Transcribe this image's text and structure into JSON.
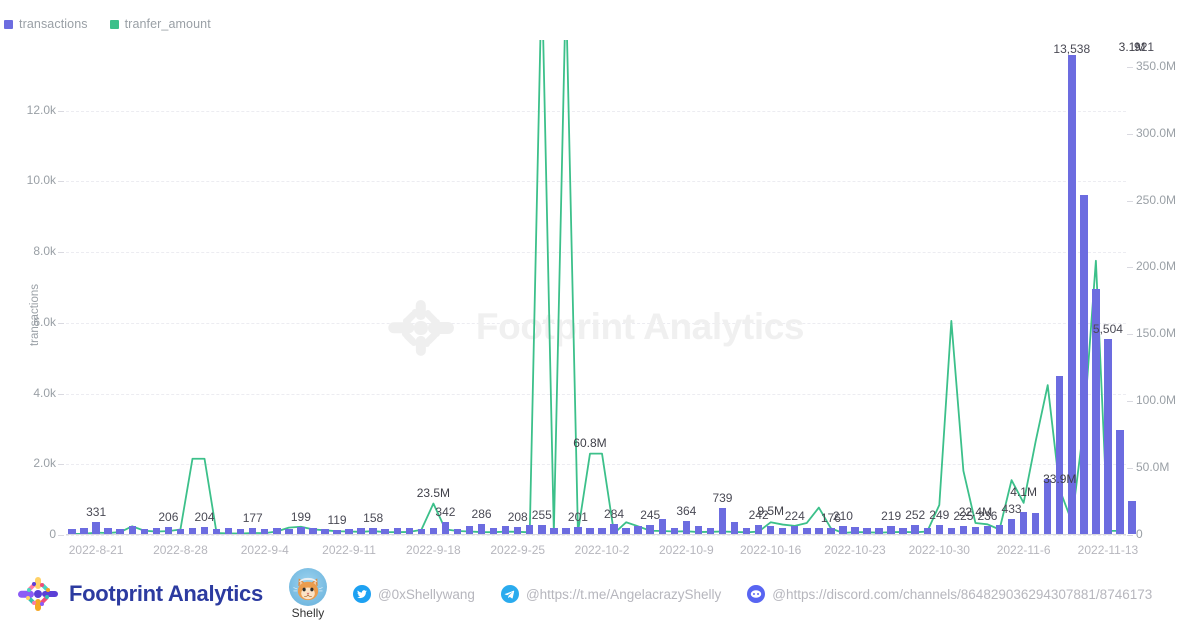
{
  "legend": {
    "items": [
      {
        "label": "transactions",
        "color": "#6c6ce0",
        "icon": "square-swatch-icon"
      },
      {
        "label": "tranfer_amount",
        "color": "#3cc08a",
        "icon": "square-swatch-icon"
      }
    ]
  },
  "watermark": {
    "text": "Footprint Analytics",
    "mark": "flower-logo-icon"
  },
  "footer": {
    "brand": {
      "name": "Footprint Analytics",
      "mark": "flower-logo-icon"
    },
    "avatar": {
      "name": "Shelly",
      "icon": "cat-avatar-icon"
    },
    "socials": [
      {
        "icon": "twitter-icon",
        "color": "#1da1f2",
        "handle": "@0xShellywang"
      },
      {
        "icon": "telegram-icon",
        "color": "#2aabee",
        "handle": "@https://t.me/AngelacrazyShelly"
      },
      {
        "icon": "discord-icon",
        "color": "#5865f2",
        "handle": "@https://discord.com/channels/864829036294307881/8746173"
      }
    ]
  },
  "chart_data": {
    "type": "bar",
    "title": "",
    "xlabel": "",
    "ylabel": "transactions",
    "y2label": "",
    "grid": true,
    "legend_position": "top-left",
    "ylim": [
      0,
      14000
    ],
    "y2lim": [
      0,
      370000000
    ],
    "yticks": [
      "0",
      "2.0k",
      "4.0k",
      "6.0k",
      "8.0k",
      "10.0k",
      "12.0k"
    ],
    "ytick_values": [
      0,
      2000,
      4000,
      6000,
      8000,
      10000,
      12000
    ],
    "y2ticks": [
      "0",
      "50.0M",
      "100.0M",
      "150.0M",
      "200.0M",
      "250.0M",
      "300.0M",
      "350.0M"
    ],
    "y2tick_values": [
      0,
      50000000,
      100000000,
      150000000,
      200000000,
      250000000,
      300000000,
      350000000
    ],
    "xticks": [
      "2022-8-21",
      "2022-8-28",
      "2022-9-4",
      "2022-9-11",
      "2022-9-18",
      "2022-9-25",
      "2022-10-2",
      "2022-10-9",
      "2022-10-16",
      "2022-10-23",
      "2022-10-30",
      "2022-11-6",
      "2022-11-13"
    ],
    "xtick_indices": [
      2,
      9,
      16,
      23,
      30,
      37,
      44,
      51,
      58,
      65,
      72,
      79,
      86
    ],
    "x": [
      "2022-8-19",
      "2022-8-20",
      "2022-8-21",
      "2022-8-22",
      "2022-8-23",
      "2022-8-24",
      "2022-8-25",
      "2022-8-26",
      "2022-8-27",
      "2022-8-28",
      "2022-8-29",
      "2022-8-30",
      "2022-8-31",
      "2022-9-1",
      "2022-9-2",
      "2022-9-3",
      "2022-9-4",
      "2022-9-5",
      "2022-9-6",
      "2022-9-7",
      "2022-9-8",
      "2022-9-9",
      "2022-9-10",
      "2022-9-11",
      "2022-9-12",
      "2022-9-13",
      "2022-9-14",
      "2022-9-15",
      "2022-9-16",
      "2022-9-17",
      "2022-9-18",
      "2022-9-19",
      "2022-9-20",
      "2022-9-21",
      "2022-9-22",
      "2022-9-23",
      "2022-9-24",
      "2022-9-25",
      "2022-9-26",
      "2022-9-27",
      "2022-9-28",
      "2022-9-29",
      "2022-9-30",
      "2022-10-1",
      "2022-10-2",
      "2022-10-3",
      "2022-10-4",
      "2022-10-5",
      "2022-10-6",
      "2022-10-7",
      "2022-10-8",
      "2022-10-9",
      "2022-10-10",
      "2022-10-11",
      "2022-10-12",
      "2022-10-13",
      "2022-10-14",
      "2022-10-15",
      "2022-10-16",
      "2022-10-17",
      "2022-10-18",
      "2022-10-19",
      "2022-10-20",
      "2022-10-21",
      "2022-10-22",
      "2022-10-23",
      "2022-10-24",
      "2022-10-25",
      "2022-10-26",
      "2022-10-27",
      "2022-10-28",
      "2022-10-29",
      "2022-10-30",
      "2022-10-31",
      "2022-11-1",
      "2022-11-2",
      "2022-11-3",
      "2022-11-4",
      "2022-11-5",
      "2022-11-6",
      "2022-11-7",
      "2022-11-8",
      "2022-11-9",
      "2022-11-10",
      "2022-11-11",
      "2022-11-12",
      "2022-11-13",
      "2022-11-14"
    ],
    "series": [
      {
        "name": "transactions",
        "type": "bar",
        "axis": "left",
        "color": "#6c6ce0",
        "values": [
          150,
          160,
          331,
          170,
          150,
          240,
          150,
          160,
          206,
          150,
          160,
          204,
          155,
          160,
          150,
          177,
          150,
          160,
          150,
          199,
          160,
          150,
          119,
          150,
          160,
          158,
          150,
          165,
          170,
          150,
          160,
          342,
          150,
          240,
          286,
          175,
          240,
          208,
          260,
          255,
          165,
          170,
          201,
          160,
          175,
          284,
          160,
          230,
          245,
          420,
          180,
          364,
          230,
          175,
          739,
          330,
          180,
          242,
          240,
          175,
          224,
          180,
          170,
          176,
          230,
          210,
          180,
          160,
          219,
          165,
          252,
          170,
          249,
          175,
          225,
          185,
          236,
          260,
          433,
          620,
          605,
          1560,
          4470,
          13538,
          9580,
          6920,
          5504,
          2950,
          921
        ]
      },
      {
        "name": "tranfer_amount",
        "type": "line",
        "axis": "right",
        "color": "#3cc08a",
        "values": [
          800000,
          900000,
          1800000,
          1500000,
          2200000,
          6500000,
          3200000,
          2600000,
          2900000,
          4100000,
          57000000,
          57000000,
          1500000,
          1200000,
          1100000,
          1500000,
          1400000,
          2600000,
          5500000,
          6200000,
          4200000,
          3500000,
          2800000,
          2600000,
          2400000,
          2900000,
          2200000,
          2100000,
          2300000,
          3800000,
          23500000,
          4200000,
          3000000,
          2600000,
          2200000,
          2100000,
          2500000,
          2400000,
          2000000,
          420000000,
          2100000,
          410000000,
          2000000,
          60800000,
          60800000,
          1200000,
          9500000,
          6500000,
          3200000,
          3000000,
          2600000,
          2800000,
          2200000,
          2400000,
          2600000,
          2300000,
          2000000,
          2500000,
          9500000,
          7800000,
          6800000,
          9000000,
          20500000,
          5000000,
          1500000,
          2200000,
          2000000,
          1800000,
          2100000,
          2300000,
          2000000,
          2600000,
          22400000,
          160000000,
          48000000,
          9000000,
          8000000,
          4100000,
          41000000,
          24000000,
          70000000,
          112000000,
          33900000,
          10000000,
          82000000,
          205000000,
          3100000,
          3100000
        ]
      }
    ],
    "point_labels": [
      {
        "index": 2,
        "text": "331",
        "series": "transactions"
      },
      {
        "index": 8,
        "text": "206",
        "series": "transactions"
      },
      {
        "index": 11,
        "text": "204",
        "series": "transactions"
      },
      {
        "index": 15,
        "text": "177",
        "series": "transactions"
      },
      {
        "index": 19,
        "text": "199",
        "series": "transactions"
      },
      {
        "index": 22,
        "text": "119",
        "series": "transactions"
      },
      {
        "index": 25,
        "text": "158",
        "series": "transactions"
      },
      {
        "index": 31,
        "text": "342",
        "series": "transactions"
      },
      {
        "index": 34,
        "text": "286",
        "series": "transactions"
      },
      {
        "index": 37,
        "text": "208",
        "series": "transactions"
      },
      {
        "index": 30,
        "text": "23.5M",
        "series": "tranfer_amount"
      },
      {
        "index": 39,
        "text": "255",
        "series": "transactions"
      },
      {
        "index": 42,
        "text": "201",
        "series": "transactions"
      },
      {
        "index": 45,
        "text": "284",
        "series": "transactions"
      },
      {
        "index": 43,
        "text": "60.8M",
        "series": "tranfer_amount"
      },
      {
        "index": 48,
        "text": "245",
        "series": "transactions"
      },
      {
        "index": 51,
        "text": "364",
        "series": "transactions"
      },
      {
        "index": 54,
        "text": "739",
        "series": "transactions"
      },
      {
        "index": 57,
        "text": "242",
        "series": "transactions"
      },
      {
        "index": 60,
        "text": "224",
        "series": "transactions"
      },
      {
        "index": 63,
        "text": "176",
        "series": "transactions"
      },
      {
        "index": 58,
        "text": "9.5M",
        "series": "tranfer_amount"
      },
      {
        "index": 64,
        "text": "210",
        "series": "transactions"
      },
      {
        "index": 68,
        "text": "219",
        "series": "transactions"
      },
      {
        "index": 70,
        "text": "252",
        "series": "transactions"
      },
      {
        "index": 72,
        "text": "249",
        "series": "transactions"
      },
      {
        "index": 74,
        "text": "225",
        "series": "transactions"
      },
      {
        "index": 76,
        "text": "236",
        "series": "transactions"
      },
      {
        "index": 75,
        "text": "22.4M",
        "series": "tranfer_amount"
      },
      {
        "index": 78,
        "text": "433",
        "series": "transactions"
      },
      {
        "index": 79,
        "text": "4.1M",
        "series": "tranfer_amount"
      },
      {
        "index": 83,
        "text": "13,538",
        "series": "transactions"
      },
      {
        "index": 86,
        "text": "5,504",
        "series": "transactions"
      },
      {
        "index": 82,
        "text": "33.9M",
        "series": "tranfer_amount"
      },
      {
        "index": 89,
        "text": "921",
        "series": "transactions"
      },
      {
        "index": 88,
        "text": "3.1M",
        "series": "tranfer_amount"
      }
    ]
  }
}
